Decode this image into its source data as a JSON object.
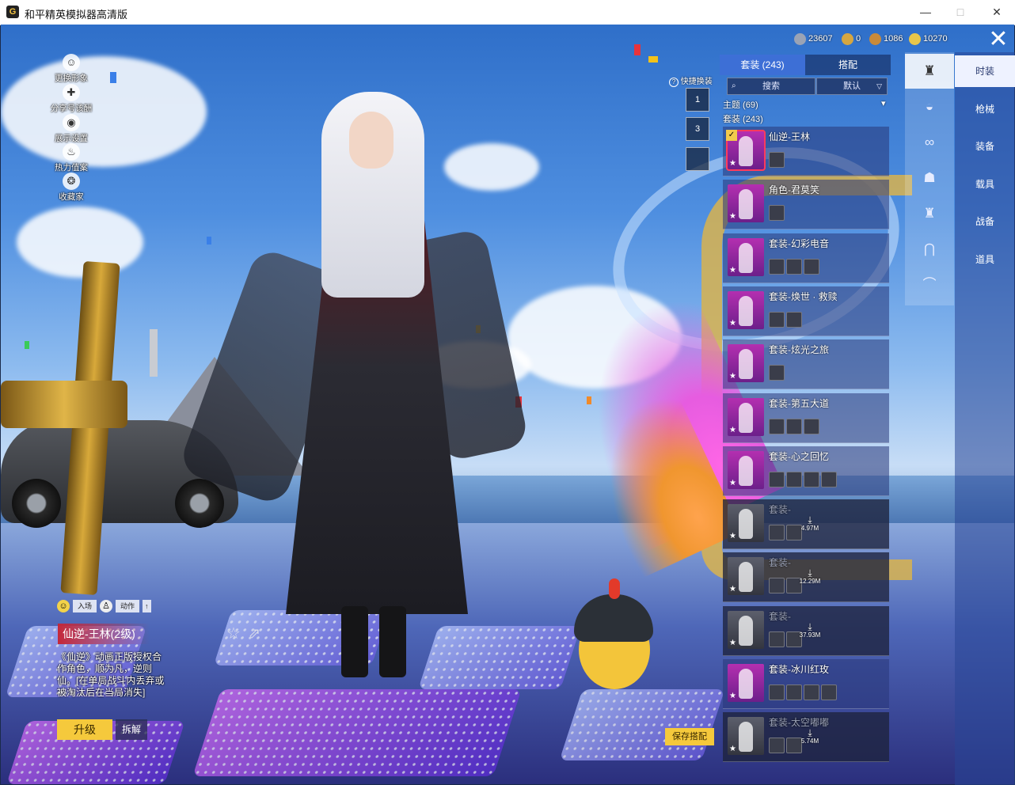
{
  "window": {
    "title": "和平精英模拟器高清版",
    "app_icon_glyph": "G",
    "minimize": "—",
    "maximize": "□",
    "close": "✕"
  },
  "left_menu": [
    {
      "label": "更换形象",
      "icon": "person-icon",
      "glyph": "☺"
    },
    {
      "label": "分享号该酬",
      "icon": "share-joystick-icon",
      "glyph": "✚"
    },
    {
      "label": "展示设置",
      "icon": "eye-icon",
      "glyph": "◉"
    },
    {
      "label": "热力值案",
      "icon": "flame-icon",
      "glyph": "♨"
    },
    {
      "label": "收藏家",
      "icon": "collector-badge-icon",
      "glyph": "❂"
    }
  ],
  "currency": [
    {
      "value": "23607",
      "color": "#9aa3b5"
    },
    {
      "value": "0",
      "color": "#d6a640"
    },
    {
      "value": "1086",
      "color": "#c98a3a"
    },
    {
      "value": "10270",
      "color": "#e8c64a"
    }
  ],
  "quick_change": {
    "label": "快捷换装",
    "help_glyph": "?",
    "slots": [
      "1",
      "3",
      ""
    ]
  },
  "panel": {
    "tabs": [
      {
        "label": "套装 (243)",
        "active": true
      },
      {
        "label": "搭配",
        "active": false
      }
    ],
    "search_label": "搜索",
    "sort_label": "默认",
    "theme_label": "主题 (69)",
    "suit_label": "套装 (243)",
    "items": [
      {
        "title": "仙逆-王林",
        "state": "selected",
        "pieces": 1,
        "download": ""
      },
      {
        "title": "角色-君莫笑",
        "state": "normal",
        "pieces": 1,
        "download": ""
      },
      {
        "title": "套装-幻彩电音",
        "state": "normal",
        "pieces": 3,
        "download": ""
      },
      {
        "title": "套装-焕世 · 救赎",
        "state": "normal",
        "pieces": 2,
        "download": ""
      },
      {
        "title": "套装-炫光之旅",
        "state": "normal",
        "pieces": 1,
        "download": ""
      },
      {
        "title": "套装-第五大道",
        "state": "normal",
        "pieces": 3,
        "download": ""
      },
      {
        "title": "套装-心之回忆",
        "state": "normal",
        "pieces": 4,
        "download": ""
      },
      {
        "title": "套装-",
        "state": "dim",
        "pieces": 2,
        "download": "4.97M"
      },
      {
        "title": "套装-",
        "state": "dim",
        "pieces": 2,
        "download": "12.29M"
      },
      {
        "title": "套装-",
        "state": "dim",
        "pieces": 2,
        "download": "37.93M"
      },
      {
        "title": "套装-冰川红玫",
        "state": "normal",
        "pieces": 4,
        "download": ""
      },
      {
        "title": "套装-太空嘟嘟",
        "state": "dim",
        "pieces": 2,
        "download": "5.74M"
      }
    ]
  },
  "categories": [
    {
      "label": "时装",
      "active": true
    },
    {
      "label": "枪械",
      "active": false
    },
    {
      "label": "装备",
      "active": false
    },
    {
      "label": "载具",
      "active": false
    },
    {
      "label": "战备",
      "active": false
    },
    {
      "label": "道具",
      "active": false
    }
  ],
  "subcategories": [
    {
      "icon": "outfit-icon",
      "glyph": "♜",
      "active": true
    },
    {
      "icon": "hat-icon",
      "glyph": "◒",
      "active": false
    },
    {
      "icon": "glasses-icon",
      "glyph": "∞",
      "active": false
    },
    {
      "icon": "mask-icon",
      "glyph": "☗",
      "active": false
    },
    {
      "icon": "top-icon",
      "glyph": "♜",
      "active": false
    },
    {
      "icon": "pants-icon",
      "glyph": "⋂",
      "active": false
    },
    {
      "icon": "shoes-icon",
      "glyph": "⌒",
      "active": false
    }
  ],
  "outfit": {
    "emote_intro": "入场",
    "emote_action": "动作",
    "name": "仙逆-王林(2级)",
    "description": "《仙逆》动画正版授权合作角色，顺为凡，逆则仙。[在单局战斗内丢弃或被淘汰后在当局消失]",
    "upgrade": "升级",
    "dismantle": "拆解",
    "save": "保存搭配"
  },
  "close_game": "✕"
}
